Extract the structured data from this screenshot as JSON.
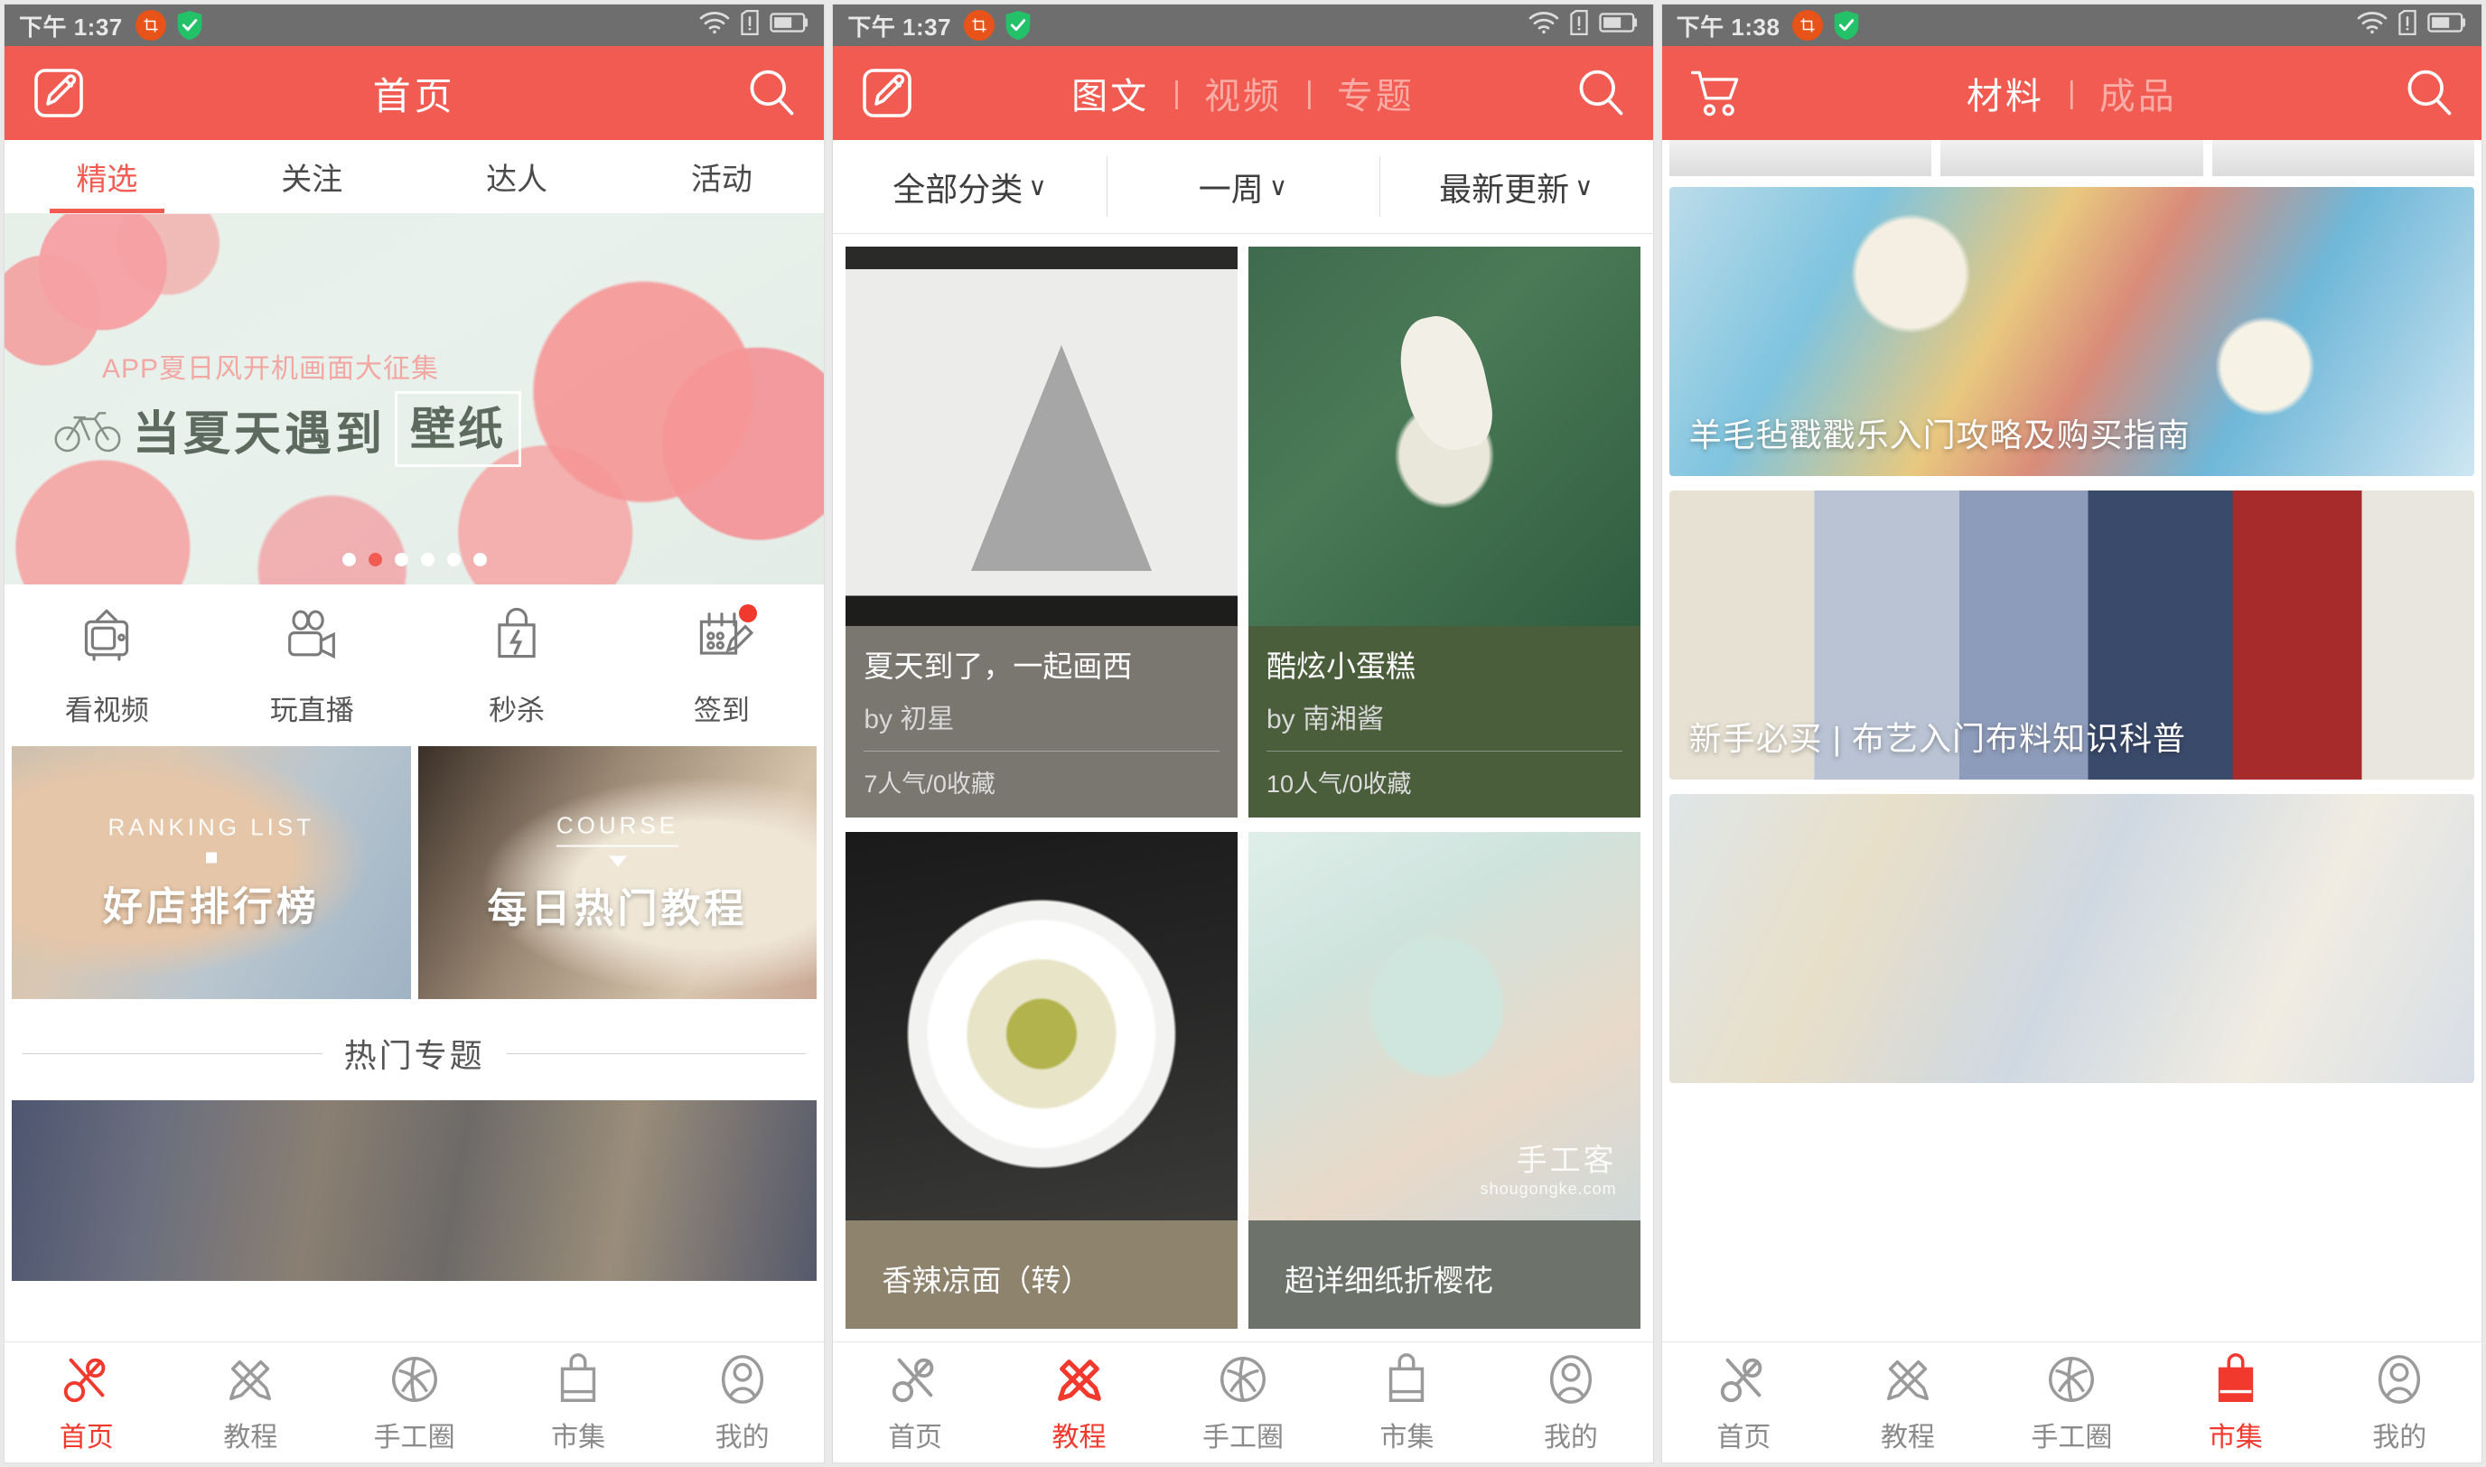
{
  "status_bar": {
    "time_p1": "下午 1:37",
    "time_p2": "下午 1:37",
    "time_p3": "下午 1:38",
    "icons": [
      "crop-icon",
      "shield-check-icon",
      "wifi-icon",
      "sim-alert-icon",
      "battery-icon"
    ]
  },
  "colors": {
    "brand_red": "#f15b51",
    "accent_red": "#f1392e",
    "status_gray": "#6e6e6e",
    "text_dark": "#4a4a4a",
    "text_muted": "#8a8a8a"
  },
  "panel1": {
    "header": {
      "lead_icon": "edit-square-icon",
      "title": "首页",
      "search_icon": "search-icon"
    },
    "tabs": [
      {
        "label": "精选",
        "active": true
      },
      {
        "label": "关注",
        "active": false
      },
      {
        "label": "达人",
        "active": false
      },
      {
        "label": "活动",
        "active": false
      }
    ],
    "banner": {
      "subtitle": "APP夏日风开机画面大征集",
      "title": "当夏天遇到",
      "highlight": "壁纸",
      "bike_icon": "bicycle-icon",
      "dots_total": 6,
      "dots_active_index": 1
    },
    "quick_actions": [
      {
        "icon": "tv-icon",
        "label": "看视频"
      },
      {
        "icon": "video-camera-icon",
        "label": "玩直播"
      },
      {
        "icon": "flash-bag-icon",
        "label": "秒杀"
      },
      {
        "icon": "checkin-pencil-icon",
        "label": "签到",
        "badge": true
      }
    ],
    "promos": [
      {
        "eng": "RANKING LIST",
        "zh": "好店排行榜",
        "marker": "square"
      },
      {
        "eng": "COURSE",
        "zh": "每日热门教程",
        "marker": "triangle"
      }
    ],
    "section": {
      "title": "热门专题"
    }
  },
  "panel2": {
    "header": {
      "lead_icon": "edit-square-icon",
      "segments": [
        {
          "label": "图文",
          "active": true
        },
        {
          "label": "视频",
          "active": false
        },
        {
          "label": "专题",
          "active": false
        }
      ],
      "divider": "|",
      "search_icon": "search-icon"
    },
    "filters": [
      {
        "label": "全部分类",
        "caret": "chevron-down-icon"
      },
      {
        "label": "一周",
        "caret": "chevron-down-icon"
      },
      {
        "label": "最新更新",
        "caret": "chevron-down-icon"
      }
    ],
    "cards": [
      {
        "title": "夏天到了，一起画西",
        "by": "by 初星",
        "stats": "7人气/0收藏"
      },
      {
        "title": "酷炫小蛋糕",
        "by": "by 南湘酱",
        "stats": "10人气/0收藏"
      },
      {
        "title": "香辣凉面（转）"
      },
      {
        "title": "超详细纸折樱花",
        "watermark_zh": "手工客",
        "watermark_en": "shougongke.com"
      }
    ]
  },
  "panel3": {
    "header": {
      "lead_icon": "shopping-cart-icon",
      "segments": [
        {
          "label": "材料",
          "active": true
        },
        {
          "label": "成品",
          "active": false
        }
      ],
      "divider": "|",
      "search_icon": "search-icon"
    },
    "items": [
      {
        "title": "羊毛毡戳戳乐入门攻略及购买指南"
      },
      {
        "title": "新手必买 | 布艺入门布料知识科普"
      },
      {
        "title": ""
      }
    ]
  },
  "bottom_nav": {
    "items": [
      {
        "icon": "scissors-icon",
        "label": "首页"
      },
      {
        "icon": "pencil-ruler-icon",
        "label": "教程"
      },
      {
        "icon": "yarn-ball-icon",
        "label": "手工圈"
      },
      {
        "icon": "shopping-bag-icon",
        "label": "市集"
      },
      {
        "icon": "user-avatar-icon",
        "label": "我的"
      }
    ],
    "active_p1": 0,
    "active_p2": 1,
    "active_p3": 3
  }
}
